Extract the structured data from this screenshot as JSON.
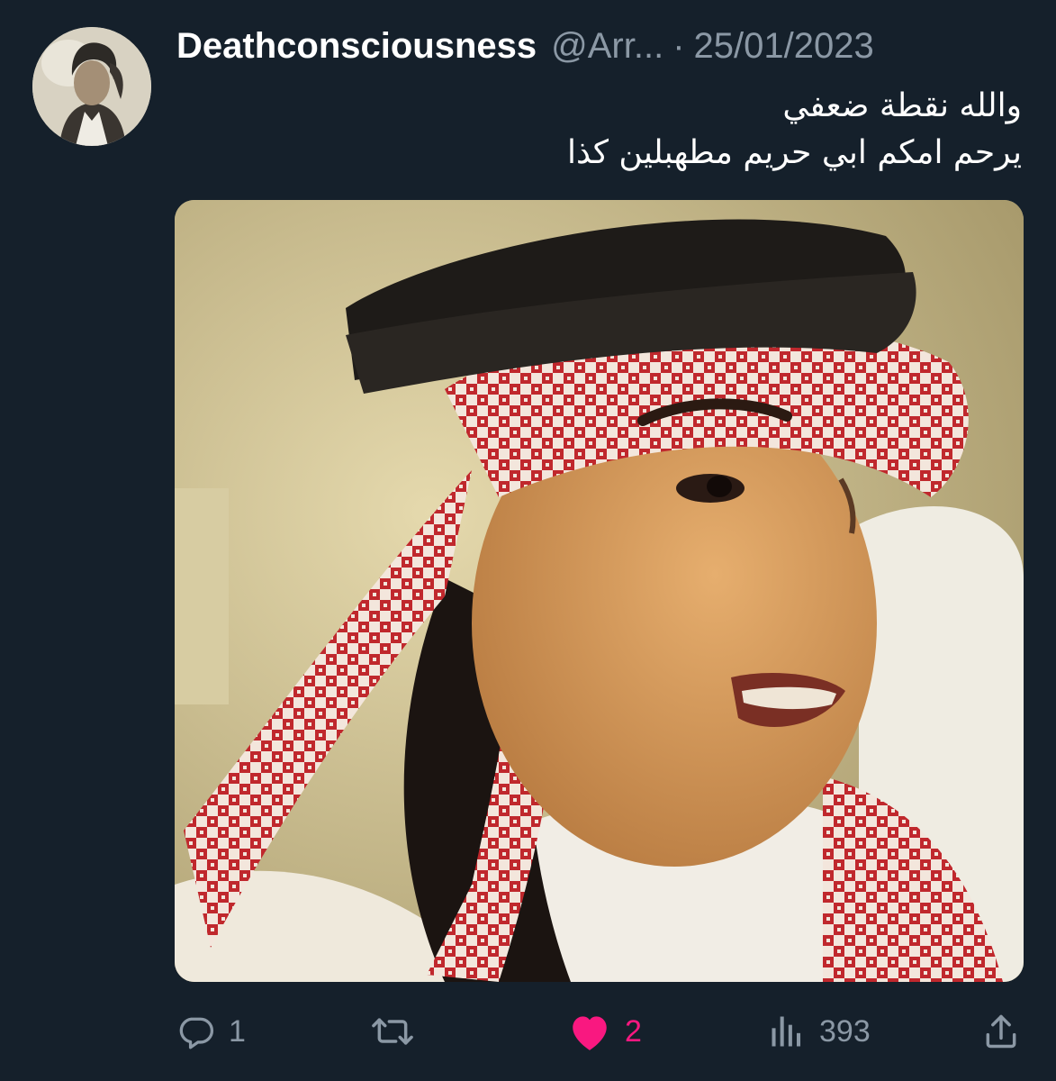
{
  "tweet": {
    "display_name": "Deathconsciousness",
    "handle": "@Arr...",
    "separator": "·",
    "date": "25/01/2023",
    "text_lines": [
      "والله نقطة ضعفي",
      "يرحم امكم ابي حريم مطهبلين كذا"
    ]
  },
  "actions": {
    "reply_count": "1",
    "retweet_count": "",
    "like_count": "2",
    "views_count": "393"
  },
  "icons": {
    "reply": "reply-icon",
    "retweet": "retweet-icon",
    "like": "heart-filled-icon",
    "views": "views-chart-icon",
    "share": "share-icon"
  },
  "colors": {
    "background": "#15202b",
    "secondary_text": "#8b98a5",
    "like_active": "#f91880"
  }
}
